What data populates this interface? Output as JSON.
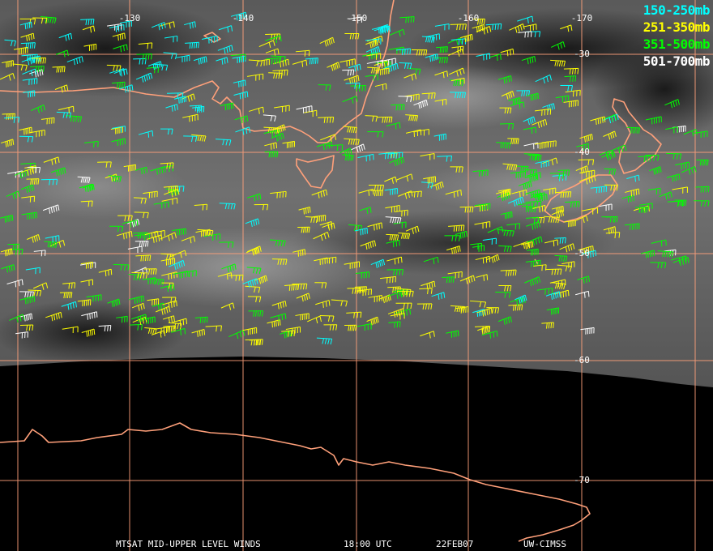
{
  "map": {
    "longitude_labels": [
      "-130",
      "-140",
      "-150",
      "-160",
      "-170"
    ],
    "latitude_labels": [
      "-30",
      "-40",
      "-50",
      "-60",
      "-70"
    ]
  },
  "legend": [
    {
      "label": "150-250mb",
      "color": "#00ffff"
    },
    {
      "label": "251-350mb",
      "color": "#ffff00"
    },
    {
      "label": "351-500mb",
      "color": "#00ff00"
    },
    {
      "label": "501-700mb",
      "color": "#ffffff"
    }
  ],
  "footer": {
    "product": "MTSAT MID-UPPER LEVEL WINDS",
    "time": "18:00 UTC",
    "date": "22FEB07",
    "source": "UW-CIMSS"
  },
  "colors": {
    "grid": "#ffa07a",
    "coastline": "#ffa07a",
    "background": "#000000"
  }
}
